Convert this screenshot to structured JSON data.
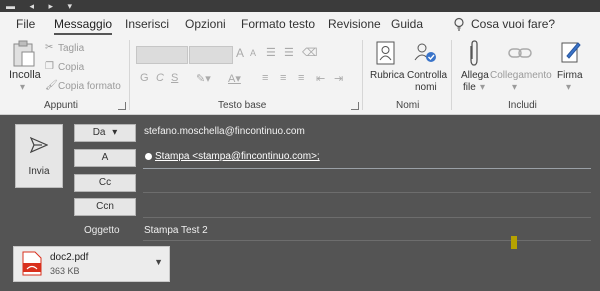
{
  "tabs": [
    "File",
    "Messaggio",
    "Inserisci",
    "Opzioni",
    "Formato testo",
    "Revisione",
    "Guida"
  ],
  "active_tab": "Messaggio",
  "search_label": "Cosa vuoi fare?",
  "ribbon": {
    "appunti": {
      "paste": "Incolla",
      "cut": "Taglia",
      "copy": "Copia",
      "format_painter": "Copia formato",
      "group_label": "Appunti"
    },
    "testo_base": {
      "bold": "G",
      "italic": "C",
      "underline": "S",
      "grow": "A",
      "shrink": "A",
      "group_label": "Testo base"
    },
    "nomi": {
      "rubrica": "Rubrica",
      "controlla_1": "Controlla",
      "controlla_2": "nomi",
      "group_label": "Nomi"
    },
    "includi": {
      "allega_1": "Allega",
      "allega_2": "file",
      "collegamento": "Collegamento",
      "firma": "Firma",
      "group_label": "Includi"
    }
  },
  "compose": {
    "send_label": "Invia",
    "from_button": "Da",
    "from_value": "stefano.moschella@fincontinuo.com",
    "to_button": "A",
    "to_value": "Stampa <stampa@fincontinuo.com>;",
    "cc_button": "Cc",
    "bcc_button": "Ccn",
    "subject_label": "Oggetto",
    "subject_value": "Stampa Test 2"
  },
  "attachment": {
    "name": "doc2.pdf",
    "size": "363 KB"
  },
  "colors": {
    "compose_bg": "#545454",
    "ribbon_bg": "#f3f3f3",
    "pdf_red": "#d9301d",
    "marker": "#b6a200"
  }
}
